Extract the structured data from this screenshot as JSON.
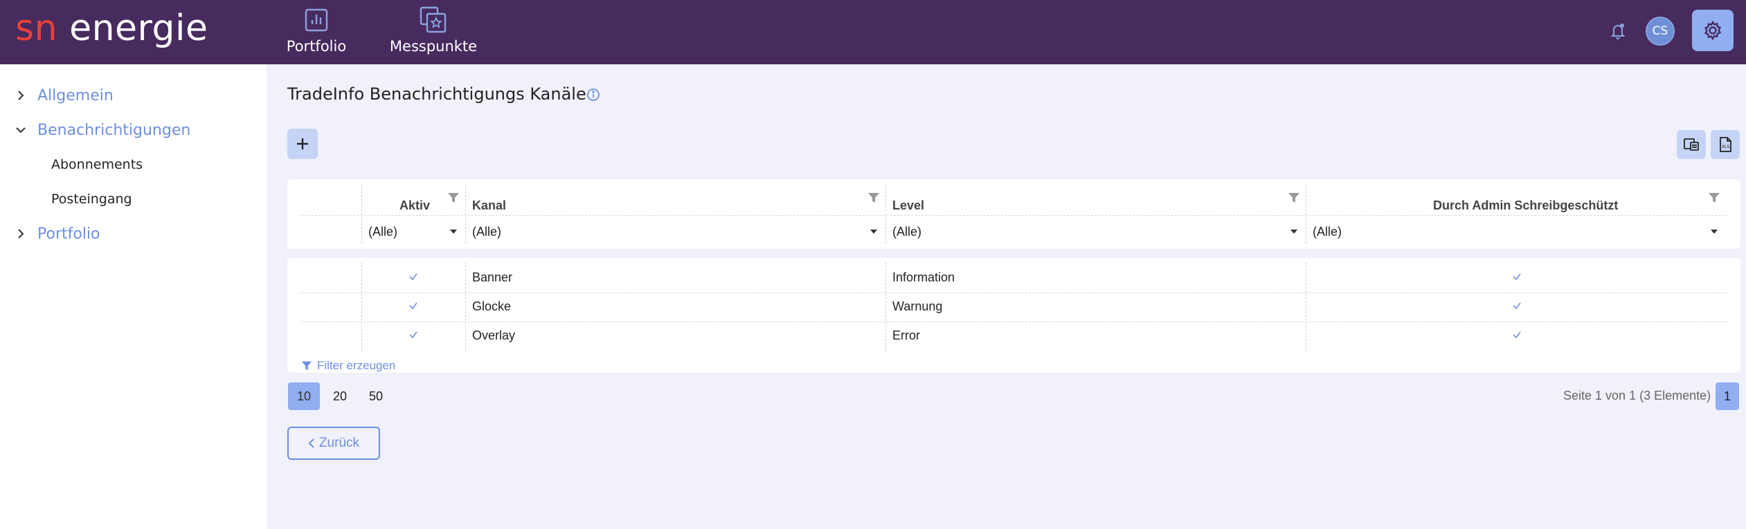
{
  "brand": {
    "prefix": "sn",
    "name": "energie"
  },
  "nav": {
    "items": [
      {
        "label": "Portfolio",
        "icon": "chart-report-icon"
      },
      {
        "label": "Messpunkte",
        "icon": "stacked-star-icon"
      }
    ],
    "avatar": "CS"
  },
  "sidebar": {
    "items": [
      {
        "label": "Allgemein",
        "expanded": false
      },
      {
        "label": "Benachrichtigungen",
        "expanded": true,
        "children": [
          "Abonnements",
          "Posteingang"
        ]
      },
      {
        "label": "Portfolio",
        "expanded": false
      }
    ]
  },
  "page": {
    "title": "TradeInfo Benachrichtigungs Kanäle"
  },
  "table": {
    "columns": [
      "Aktiv",
      "Kanal",
      "Level",
      "Durch Admin Schreibgeschützt"
    ],
    "filters": [
      "(Alle)",
      "(Alle)",
      "(Alle)",
      "(Alle)"
    ],
    "rows": [
      {
        "aktiv": true,
        "kanal": "Banner",
        "level": "Information",
        "admin": true
      },
      {
        "aktiv": true,
        "kanal": "Glocke",
        "level": "Warnung",
        "admin": true
      },
      {
        "aktiv": true,
        "kanal": "Overlay",
        "level": "Error",
        "admin": true
      }
    ],
    "filter_link": "Filter erzeugen"
  },
  "pager": {
    "sizes": [
      "10",
      "20",
      "50"
    ],
    "active_size": "10",
    "info": "Seite 1 von 1 (3 Elemente)",
    "current_page": "1"
  },
  "back_label": "Zurück",
  "colors": {
    "topbar": "#472a5e",
    "accent": "#6e8fe0",
    "brand_red": "#e8403a"
  }
}
